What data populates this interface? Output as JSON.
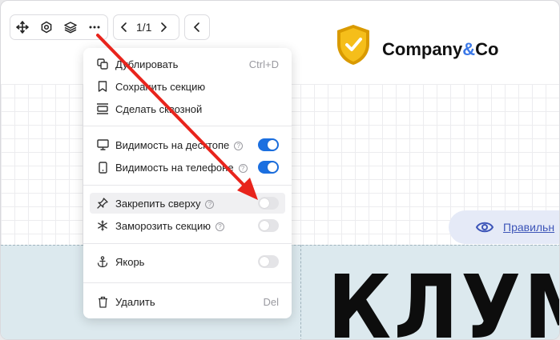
{
  "toolbar": {
    "pager_label": "1/1",
    "icons": [
      "move-icon",
      "settings-icon",
      "layers-icon",
      "more-icon",
      "prev-icon",
      "next-icon",
      "collapse-icon"
    ]
  },
  "brand": {
    "name_part1": "Company",
    "name_amp": "&",
    "name_part2": "Co",
    "accent_color": "#3b78e7",
    "shield_color": "#f0b400"
  },
  "preview_pill": {
    "label": "Правильн"
  },
  "hero": {
    "text": "КЛУМ"
  },
  "menu": {
    "duplicate": {
      "label": "Дублировать",
      "shortcut": "Ctrl+D"
    },
    "save_section": {
      "label": "Сохранить секцию"
    },
    "make_global": {
      "label": "Сделать сквозной"
    },
    "desktop_visibility": {
      "label": "Видимость на десктопе",
      "enabled": true
    },
    "phone_visibility": {
      "label": "Видимость на телефоне",
      "enabled": true
    },
    "pin_top": {
      "label": "Закрепить сверху",
      "enabled": false
    },
    "freeze_section": {
      "label": "Заморозить секцию",
      "enabled": false
    },
    "anchor": {
      "label": "Якорь",
      "enabled": false
    },
    "delete": {
      "label": "Удалить",
      "shortcut": "Del"
    },
    "help_glyph": "?"
  },
  "colors": {
    "toggle_on": "#1b6fe0",
    "annotation_arrow": "#e8241c"
  }
}
